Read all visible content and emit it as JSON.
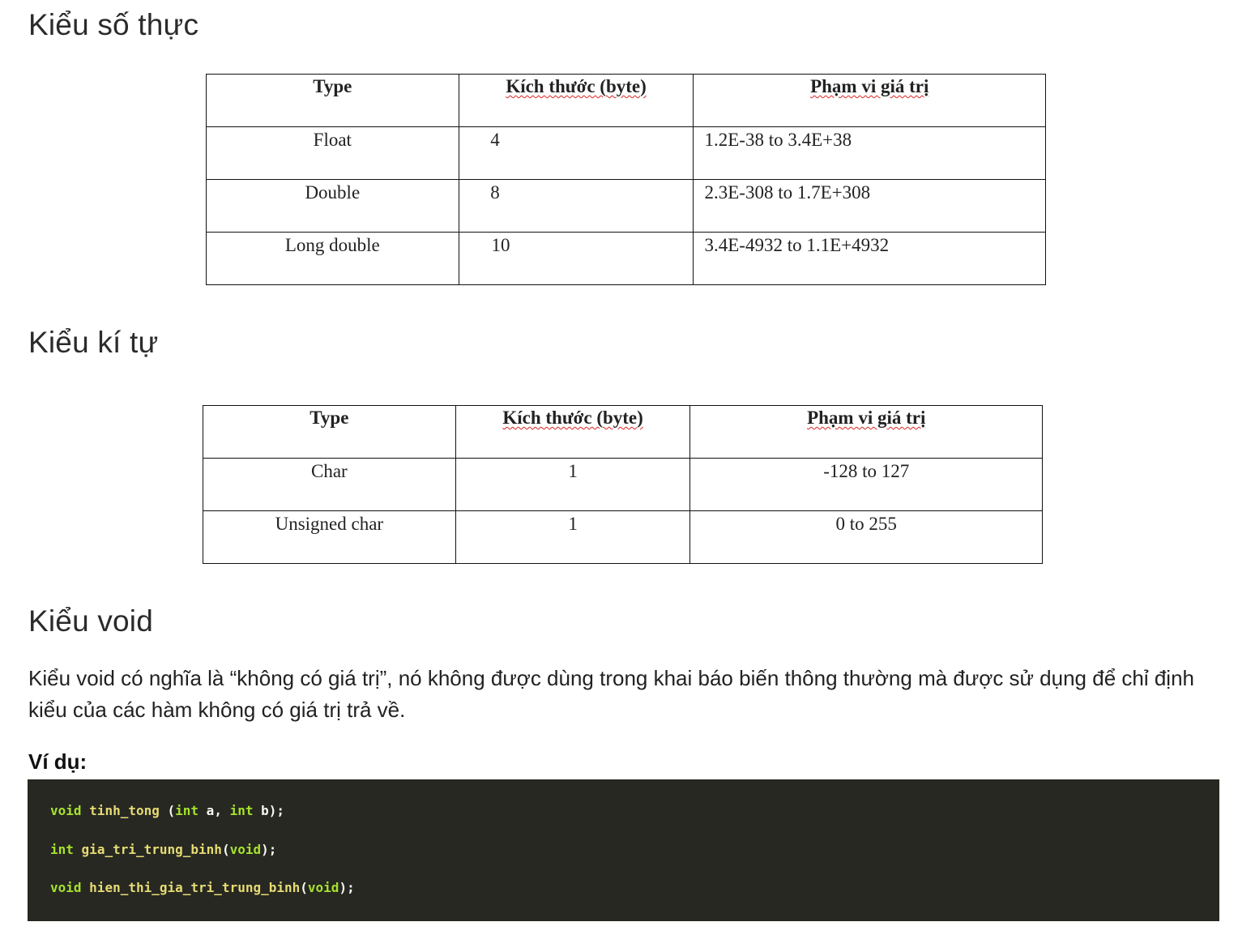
{
  "sections": {
    "float_heading": "Kiểu số thực",
    "char_heading": "Kiểu kí tự",
    "void_heading": "Kiểu void"
  },
  "float_table": {
    "headers": [
      "Type",
      "Kích thước (byte)",
      "Phạm vi giá trị"
    ],
    "rows": [
      [
        "Float",
        "4",
        "1.2E-38 to 3.4E+38"
      ],
      [
        "Double",
        "8",
        "2.3E-308 to 1.7E+308"
      ],
      [
        "Long double",
        "10",
        "3.4E-4932 to 1.1E+4932"
      ]
    ]
  },
  "char_table": {
    "headers": [
      "Type",
      "Kích thước (byte)",
      "Phạm vi giá trị"
    ],
    "rows": [
      [
        "Char",
        "1",
        "-128 to 127"
      ],
      [
        "Unsigned char",
        "1",
        "0 to 255"
      ]
    ]
  },
  "void_description": "Kiểu void có nghĩa là “không có giá trị”, nó không được dùng trong khai báo biến thông thường mà được sử dụng để chỉ định kiểu của các hàm không có giá trị trả về.",
  "example_label": "Ví dụ:",
  "code": {
    "line1": {
      "kw": "void",
      "fn": "tinh_tong",
      "open": " (",
      "p1t": "int",
      "p1": " a",
      "comma": ",",
      "p2t": "int",
      "p2": " b",
      "close": ");"
    },
    "line2": {
      "kw": "int",
      "fn": "gia_tri_trung_binh",
      "open": "(",
      "arg": "void",
      "close": ");"
    },
    "line3": {
      "kw": "void",
      "fn": "hien_thi_gia_tri_trung_binh",
      "open": "(",
      "arg": "void",
      "close": ");"
    }
  },
  "colors": {
    "code_background": "#272822",
    "keyword": "#a6e22e",
    "function_name": "#e6db74",
    "punctuation": "#f8f8f2"
  }
}
